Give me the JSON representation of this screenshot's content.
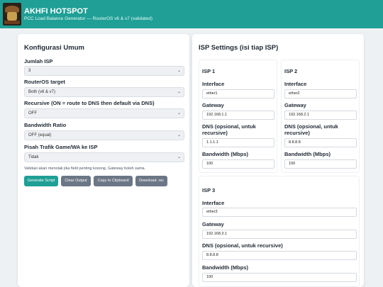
{
  "header": {
    "title": "AKHFI HOTSPOT",
    "subtitle": "PCC Load Balance Generator — RouterOS v6 & v7 (validated)"
  },
  "left": {
    "title": "Konfigurasi Umum",
    "fields": [
      {
        "label": "Jumlah ISP",
        "value": "3"
      },
      {
        "label": "RouterOS target",
        "value": "Both (v6 & v7)"
      },
      {
        "label": "Recursive (ON = route to DNS then default via DNS)",
        "value": "OFF"
      },
      {
        "label": "Bandwidth Ratio",
        "value": "OFF (equal)"
      },
      {
        "label": "Pisah Trafik Game/WA ke ISP",
        "value": "Tidak"
      }
    ],
    "hint": "Validasi akan menolak jika field penting kosong. Gateway boleh sama.",
    "buttons": {
      "generate": "Generate Script",
      "clear": "Clear Output",
      "copy": "Copy to Clipboard",
      "download": "Download .rsc"
    }
  },
  "right": {
    "title": "ISP Settings (isi tiap ISP)",
    "labels": {
      "interface": "Interface",
      "gateway": "Gateway",
      "dns": "DNS (opsional, untuk recursive)",
      "bandwidth": "Bandwidth (Mbps)"
    },
    "isps": [
      {
        "title": "ISP 1",
        "interface": "ether1",
        "gateway": "192.168.1.1",
        "dns": "1.1.1.1",
        "bandwidth": "100"
      },
      {
        "title": "ISP 2",
        "interface": "ether2",
        "gateway": "192.168.2.1",
        "dns": "8.8.8.8",
        "bandwidth": "100"
      },
      {
        "title": "ISP 3",
        "interface": "ether3",
        "gateway": "192.168.3.1",
        "dns": "8.8.8.8",
        "bandwidth": "100"
      }
    ]
  },
  "colors": {
    "accent": "#1f9f95",
    "secondary_button": "#6b7686",
    "background": "#eef1f4"
  }
}
